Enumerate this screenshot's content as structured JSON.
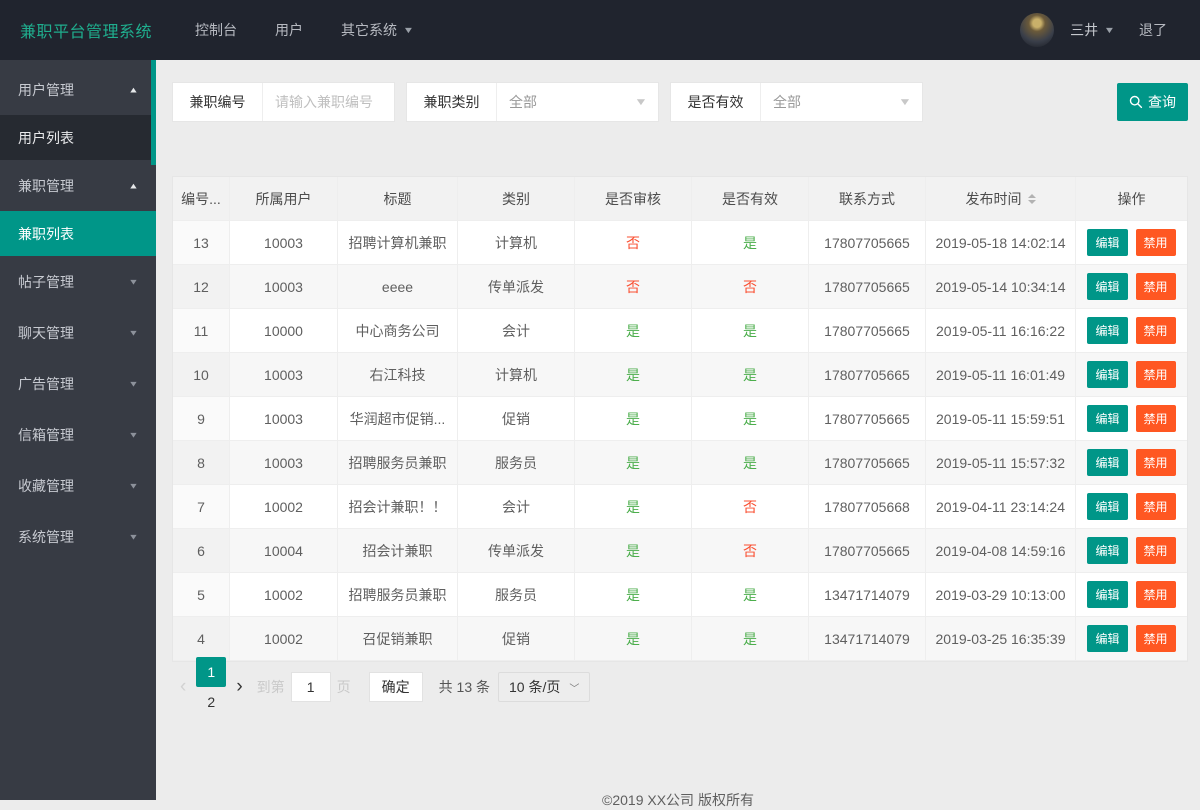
{
  "navbar": {
    "brand": "兼职平台管理系统",
    "items": [
      {
        "label": "控制台"
      },
      {
        "label": "用户"
      },
      {
        "label": "其它系统",
        "has_dropdown": true
      }
    ],
    "username": "三井",
    "logout": "退了"
  },
  "sidebar": {
    "items": [
      {
        "label": "用户管理",
        "name": "user-management",
        "type": "parent",
        "state": "expanded",
        "active": false
      },
      {
        "label": "用户列表",
        "name": "user-list",
        "type": "child",
        "active": false
      },
      {
        "label": "兼职管理",
        "name": "job-management",
        "type": "parent",
        "state": "expanded",
        "active": false
      },
      {
        "label": "兼职列表",
        "name": "job-list",
        "type": "child",
        "active": true
      },
      {
        "label": "帖子管理",
        "name": "post-management",
        "type": "parent",
        "state": "collapsed",
        "active": false
      },
      {
        "label": "聊天管理",
        "name": "chat-management",
        "type": "parent",
        "state": "collapsed",
        "active": false
      },
      {
        "label": "广告管理",
        "name": "ad-management",
        "type": "parent",
        "state": "collapsed",
        "active": false
      },
      {
        "label": "信箱管理",
        "name": "mailbox-management",
        "type": "parent",
        "state": "collapsed",
        "active": false
      },
      {
        "label": "收藏管理",
        "name": "favorites-management",
        "type": "parent",
        "state": "collapsed",
        "active": false
      },
      {
        "label": "系统管理",
        "name": "system-management",
        "type": "parent",
        "state": "collapsed",
        "active": false
      }
    ]
  },
  "filters": {
    "job_id": {
      "label": "兼职编号",
      "placeholder": "请输入兼职编号",
      "value": ""
    },
    "job_type": {
      "label": "兼职类别",
      "value": "全部"
    },
    "is_valid": {
      "label": "是否有效",
      "value": "全部"
    },
    "search_label": "查询"
  },
  "table": {
    "columns": [
      "编号...",
      "所属用户",
      "标题",
      "类别",
      "是否审核",
      "是否有效",
      "联系方式",
      "发布时间",
      "操作"
    ],
    "sortable_column_index": 7,
    "actions": {
      "edit": "编辑",
      "disable": "禁用"
    },
    "rows": [
      {
        "id": "13",
        "user": "10003",
        "title": "招聘计算机兼职",
        "category": "计算机",
        "audited": "否",
        "valid": "是",
        "contact": "17807705665",
        "time": "2019-05-18 14:02:14"
      },
      {
        "id": "12",
        "user": "10003",
        "title": "eeee",
        "category": "传单派发",
        "audited": "否",
        "valid": "否",
        "contact": "17807705665",
        "time": "2019-05-14 10:34:14"
      },
      {
        "id": "11",
        "user": "10000",
        "title": "中心商务公司",
        "category": "会计",
        "audited": "是",
        "valid": "是",
        "contact": "17807705665",
        "time": "2019-05-11 16:16:22"
      },
      {
        "id": "10",
        "user": "10003",
        "title": "右江科技",
        "category": "计算机",
        "audited": "是",
        "valid": "是",
        "contact": "17807705665",
        "time": "2019-05-11 16:01:49"
      },
      {
        "id": "9",
        "user": "10003",
        "title": "华润超市促销...",
        "category": "促销",
        "audited": "是",
        "valid": "是",
        "contact": "17807705665",
        "time": "2019-05-11 15:59:51"
      },
      {
        "id": "8",
        "user": "10003",
        "title": "招聘服务员兼职",
        "category": "服务员",
        "audited": "是",
        "valid": "是",
        "contact": "17807705665",
        "time": "2019-05-11 15:57:32"
      },
      {
        "id": "7",
        "user": "10002",
        "title": "招会计兼职！！",
        "category": "会计",
        "audited": "是",
        "valid": "否",
        "contact": "17807705668",
        "time": "2019-04-11 23:14:24"
      },
      {
        "id": "6",
        "user": "10004",
        "title": "招会计兼职",
        "category": "传单派发",
        "audited": "是",
        "valid": "否",
        "contact": "17807705665",
        "time": "2019-04-08 14:59:16"
      },
      {
        "id": "5",
        "user": "10002",
        "title": "招聘服务员兼职",
        "category": "服务员",
        "audited": "是",
        "valid": "是",
        "contact": "13471714079",
        "time": "2019-03-29 10:13:00"
      },
      {
        "id": "4",
        "user": "10002",
        "title": "召促销兼职",
        "category": "促销",
        "audited": "是",
        "valid": "是",
        "contact": "13471714079",
        "time": "2019-03-25 16:35:39"
      }
    ]
  },
  "pagination": {
    "pages": [
      "1",
      "2"
    ],
    "current": "1",
    "goto_prefix": "到第",
    "goto_value": "1",
    "goto_suffix": "页",
    "confirm": "确定",
    "total": "共 13 条",
    "page_size": "10 条/页"
  },
  "footer": {
    "copyright": "©2019 XX公司 版权所有"
  },
  "colors": {
    "accent": "#009688",
    "brand_text": "#1fae8e",
    "disable_orange": "#ff5722",
    "yes_green": "#4cae4c",
    "no_red": "#fa4f31",
    "navbar_bg": "#20242e",
    "sidebar_bg": "#373b44"
  }
}
